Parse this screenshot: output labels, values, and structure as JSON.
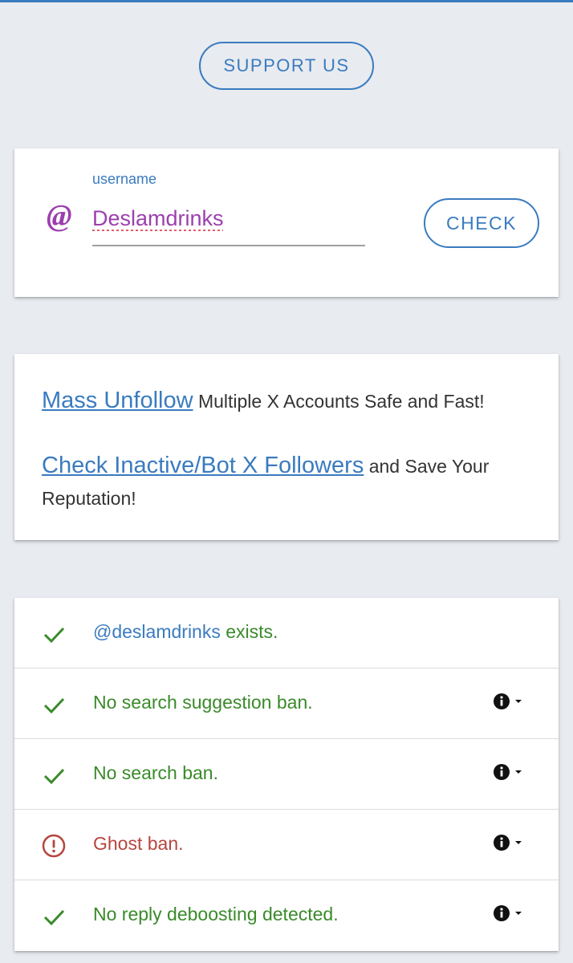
{
  "support_button": {
    "label": "SUPPORT US"
  },
  "username_field": {
    "label": "username",
    "value": "Deslamdrinks",
    "prefix": "@"
  },
  "check_button": {
    "label": "CHECK"
  },
  "promo": [
    {
      "link": "Mass Unfollow",
      "text": "Multiple X Accounts Safe and Fast!"
    },
    {
      "link": "Check Inactive/Bot X Followers",
      "text": "and Save Your Reputation!"
    }
  ],
  "results": [
    {
      "status": "ok",
      "handle": "@deslamdrinks",
      "text": "exists.",
      "has_info": false
    },
    {
      "status": "ok",
      "text": "No search suggestion ban.",
      "has_info": true
    },
    {
      "status": "ok",
      "text": "No search ban.",
      "has_info": true
    },
    {
      "status": "warning",
      "text": "Ghost ban.",
      "has_info": true
    },
    {
      "status": "ok",
      "text": "No reply deboosting detected.",
      "has_info": true
    }
  ],
  "icons": {
    "ok": "check-icon",
    "warning": "alert-circle-icon",
    "info": "info-icon",
    "dropdown": "caret-down-icon"
  },
  "colors": {
    "accent": "#3a7bbf",
    "username": "#9c3fae",
    "success": "#3a8a2a",
    "error": "#b6463f",
    "background": "#e8ebf0"
  }
}
